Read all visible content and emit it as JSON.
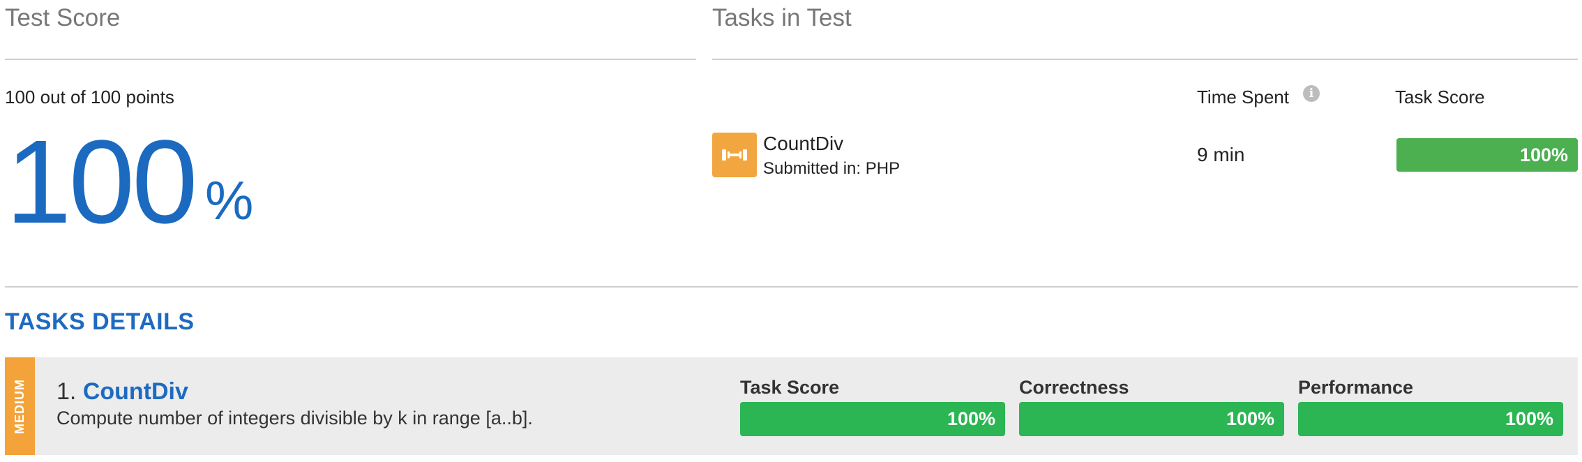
{
  "test_score": {
    "title": "Test Score",
    "points_text": "100 out of 100 points",
    "percent_value": "100",
    "percent_sign": "%"
  },
  "tasks_in_test": {
    "title": "Tasks in Test",
    "col_time_spent": "Time Spent",
    "col_task_score": "Task Score",
    "task": {
      "name": "CountDiv",
      "submitted": "Submitted in: PHP",
      "time_spent": "9 min",
      "score_label": "100%",
      "score_fraction": 1.0,
      "icon": "dumbbell-icon"
    }
  },
  "tasks_details": {
    "title": "TASKS DETAILS",
    "items": [
      {
        "difficulty": "MEDIUM",
        "number": "1.",
        "name": "CountDiv",
        "description": "Compute number of integers divisible by k in range [a..b].",
        "metrics": [
          {
            "label": "Task Score",
            "value": "100%",
            "fraction": 1.0
          },
          {
            "label": "Correctness",
            "value": "100%",
            "fraction": 1.0
          },
          {
            "label": "Performance",
            "value": "100%",
            "fraction": 1.0
          }
        ]
      }
    ]
  },
  "colors": {
    "accent_blue": "#1b6ac0",
    "bar_green_top": "#4caf50",
    "bar_green_detail": "#2cb553",
    "difficulty_orange": "#f3a33a",
    "icon_orange": "#f2a640"
  }
}
